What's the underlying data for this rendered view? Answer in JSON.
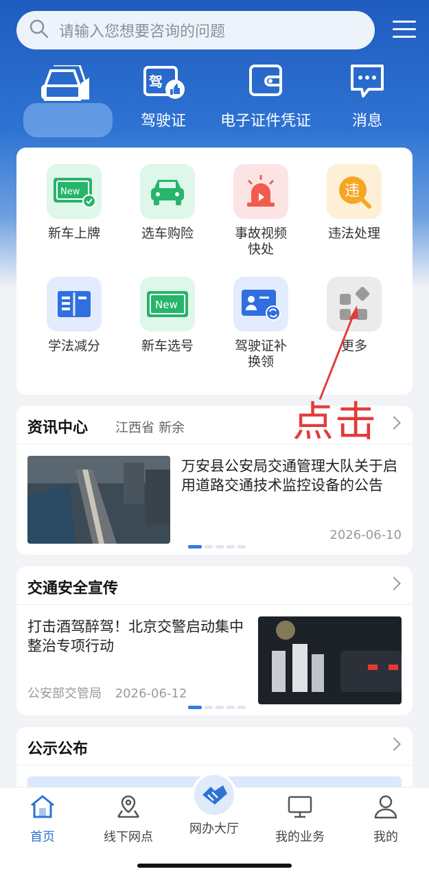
{
  "search": {
    "placeholder": "请输入您想要咨询的问题"
  },
  "quick_links": [
    {
      "label": "驾驶证",
      "icon": "license-icon"
    },
    {
      "label": "电子证件凭证",
      "icon": "wallet-icon"
    },
    {
      "label": "消息",
      "icon": "message-icon"
    }
  ],
  "services": [
    {
      "label": "新车上牌",
      "icon": "new-plate-icon",
      "color": "#dff6ea"
    },
    {
      "label": "选车购险",
      "icon": "car-insurance-icon",
      "color": "#dff6ea"
    },
    {
      "label": "事故视频快处",
      "icon": "alarm-icon",
      "color": "#fde4e4"
    },
    {
      "label": "违法处理",
      "icon": "violation-icon",
      "color": "#fdf0d6"
    },
    {
      "label": "学法减分",
      "icon": "book-icon",
      "color": "#e3ecfc"
    },
    {
      "label": "新车选号",
      "icon": "plate-select-icon",
      "color": "#dff6ea"
    },
    {
      "label": "驾驶证补换领",
      "icon": "license-replace-icon",
      "color": "#e3ecfc"
    },
    {
      "label": "更多",
      "icon": "more-icon",
      "color": "#ebebeb"
    }
  ],
  "annotation": {
    "text": "点击"
  },
  "news": {
    "title": "资讯中心",
    "region": "江西省 新余",
    "headline": "万安县公安局交通管理大队关于启用道路交通技术监控设备的公告",
    "date": "2026-06-10"
  },
  "safety": {
    "title": "交通安全宣传",
    "headline": "打击酒驾醉驾！北京交警启动集中整治专项行动",
    "source": "公安部交管局",
    "date": "2026-06-12"
  },
  "notice": {
    "title": "公示公布"
  },
  "tabs": [
    {
      "label": "首页",
      "icon": "home-icon"
    },
    {
      "label": "线下网点",
      "icon": "map-pin-icon"
    },
    {
      "label": "网办大厅",
      "icon": "handshake-icon"
    },
    {
      "label": "我的业务",
      "icon": "monitor-icon"
    },
    {
      "label": "我的",
      "icon": "user-icon"
    }
  ],
  "colors": {
    "primary": "#2e73d3",
    "annotation": "#e33b3b"
  }
}
